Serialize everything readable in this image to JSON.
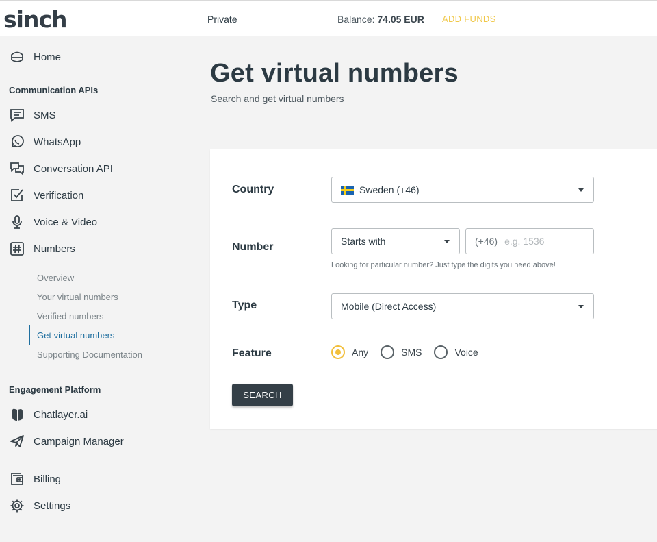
{
  "header": {
    "logo": "sinch",
    "account": "Private",
    "balance_label": "Balance:",
    "balance_value": "74.05 EUR",
    "add_funds": "ADD FUNDS"
  },
  "sidebar": {
    "home": "Home",
    "section_comm": "Communication APIs",
    "sms": "SMS",
    "whatsapp": "WhatsApp",
    "conversation": "Conversation API",
    "verification": "Verification",
    "voice": "Voice & Video",
    "numbers": "Numbers",
    "numbers_sub": [
      "Overview",
      "Your virtual numbers",
      "Verified numbers",
      "Get virtual numbers",
      "Supporting Documentation"
    ],
    "section_engage": "Engagement Platform",
    "chatlayer": "Chatlayer.ai",
    "campaign": "Campaign Manager",
    "billing": "Billing",
    "settings": "Settings"
  },
  "main": {
    "title": "Get virtual numbers",
    "subtitle": "Search and get virtual numbers",
    "form": {
      "country_label": "Country",
      "country_value": "Sweden (+46)",
      "number_label": "Number",
      "number_mode": "Starts with",
      "number_prefix": "(+46)",
      "number_placeholder": "e.g. 1536",
      "number_hint": "Looking for particular number? Just type the digits you need above!",
      "type_label": "Type",
      "type_value": "Mobile (Direct Access)",
      "feature_label": "Feature",
      "feature_options": [
        "Any",
        "SMS",
        "Voice"
      ],
      "feature_selected": "Any",
      "search_button": "SEARCH"
    }
  },
  "colors": {
    "accent": "#f2bf3b",
    "active_link": "#1f6f9f",
    "button": "#343f47"
  }
}
